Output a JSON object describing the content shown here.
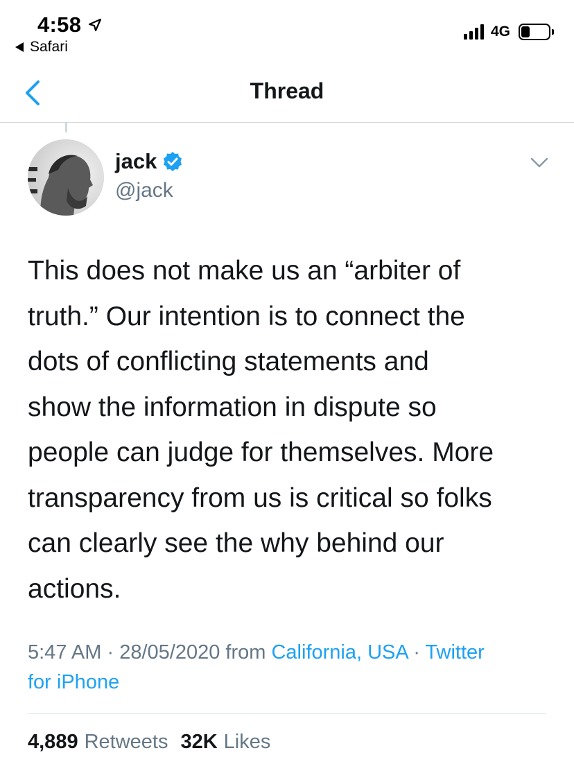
{
  "status_bar": {
    "time": "4:58",
    "back_app": "Safari",
    "network": "4G"
  },
  "nav": {
    "title": "Thread"
  },
  "tweet": {
    "display_name": "jack",
    "handle": "@jack",
    "lines": [
      "This does not make us an “arbiter of",
      "truth.” Our intention is to connect the",
      "dots of conflicting statements and",
      "show the information in dispute so",
      "people can judge for themselves. More",
      "transparency from us is critical so folks",
      "can clearly see the why behind our",
      "actions."
    ],
    "time": "5:47 AM",
    "date": "28/05/2020",
    "from_label": "from",
    "location": "California, USA",
    "separator": "·",
    "source_part1": "Twitter",
    "source_part2": "for iPhone"
  },
  "stats": {
    "retweets_count": "4,889",
    "retweets_label": "Retweets",
    "likes_count": "32K",
    "likes_label": "Likes"
  },
  "colors": {
    "accent": "#1da1f2",
    "secondary_text": "#657786",
    "primary_text": "#14171a"
  },
  "icons": {
    "location": "location-arrow-icon",
    "back_app": "back-triangle-icon",
    "signal": "cellular-signal-icon",
    "battery": "battery-icon",
    "nav_back": "chevron-left-icon",
    "verified": "verified-badge-icon",
    "more": "chevron-down-icon"
  }
}
